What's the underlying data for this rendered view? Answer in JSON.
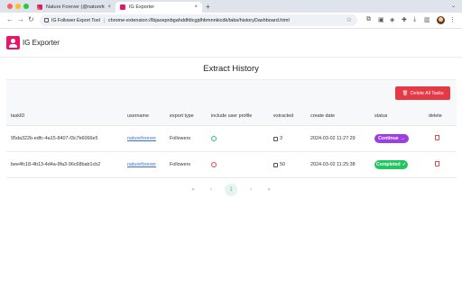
{
  "browser": {
    "tabs": [
      {
        "title": "Nature Forever (@natureforever)",
        "active": false
      },
      {
        "title": "IG Exporter",
        "active": true
      }
    ],
    "new_tab": "+",
    "address": {
      "extension_name": "IG Follower Export Tool",
      "url": "chrome-extension://lbjaoxpnbgahddfdicgjdhbmnnkicdk/tabs/historyDashboard.html"
    }
  },
  "app": {
    "name": "IG Exporter",
    "brand_color": "#e8166a"
  },
  "page": {
    "title": "Extract History",
    "delete_all_label": "Delete All Tasks",
    "columns": [
      "taskID",
      "username",
      "export type",
      "include user profile",
      "extracted",
      "create date",
      "status",
      "delete"
    ],
    "rows": [
      {
        "task_id": "95da322b-edfc-4a15-8407-f3c7b6066e5",
        "username": "natureforever",
        "export_type": "Followers",
        "include_user_profile": "yes",
        "extracted": "3",
        "create_date": "2024-03-02 11:27:29",
        "status": "Continue",
        "status_color": "#9b3fe0"
      },
      {
        "task_id": "bee4fc18-4b13-4d4a-9fa3-96c68bab1cb2",
        "username": "natureforever",
        "export_type": "Followers",
        "include_user_profile": "no",
        "extracted": "50",
        "create_date": "2024-03-02 11:25:38",
        "status": "Completed",
        "status_color": "#22c55e"
      }
    ],
    "pagination": {
      "first": "«",
      "prev": "‹",
      "current": "1",
      "next": "›",
      "last": "»"
    }
  }
}
